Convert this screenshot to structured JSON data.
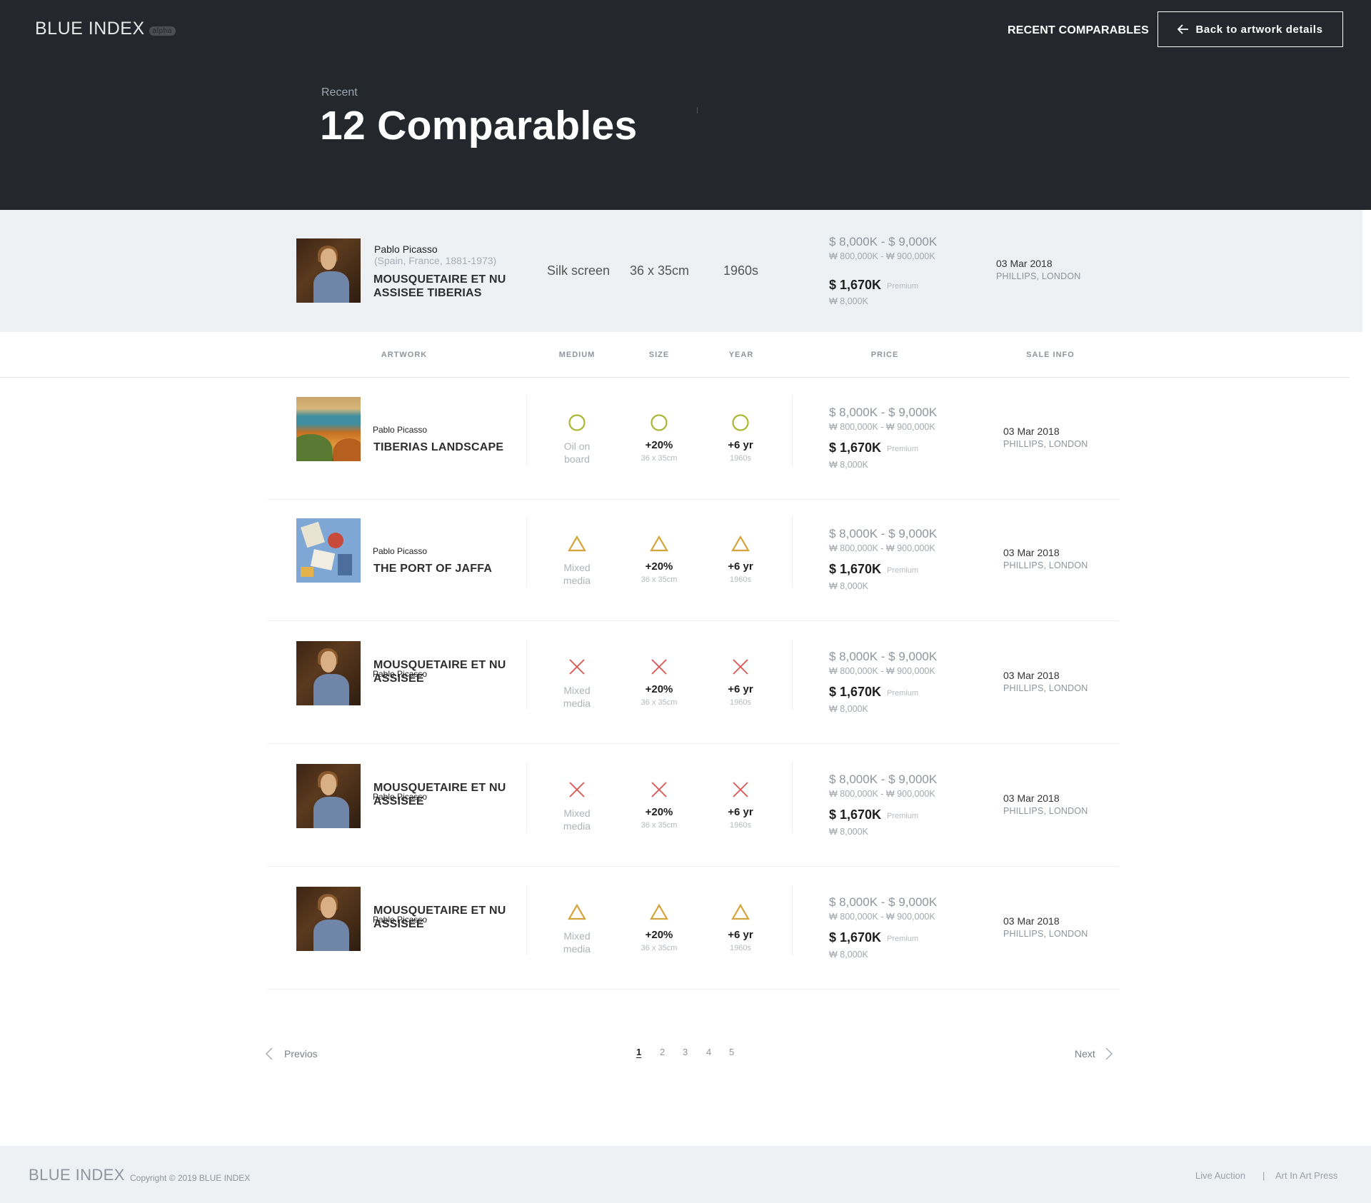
{
  "header": {
    "logo": "BLUE INDEX",
    "logo_badge": "alpha",
    "nav_recent": "RECENT COMPARABLES",
    "back_label": "Back to artwork details",
    "eyebrow": "Recent",
    "title": "12 Comparables"
  },
  "reference": {
    "artist": "Pablo Picasso",
    "artist_info": "(Spain, France, 1881-1973)",
    "title": "MOUSQUETAIRE ET NU ASSISEE TIBERIAS",
    "medium": "Silk screen",
    "size": "36 x 35cm",
    "year": "1960s",
    "estimate_usd": "$ 8,000K - $ 9,000K",
    "estimate_krw": "₩ 800,000K - ₩ 900,000K",
    "price_usd": "$ 1,670K",
    "premium_label": "Premium",
    "price_krw": "₩ 8,000K",
    "sale_date": "03 Mar 2018",
    "sale_house": "PHILLIPS, LONDON"
  },
  "columns": {
    "artwork": "ARTWORK",
    "medium": "MEDIUM",
    "size": "SIZE",
    "year": "YEAR",
    "price": "PRICE",
    "sale_info": "SALE INFO"
  },
  "rows": [
    {
      "artist": "Pablo Picasso",
      "title": "TIBERIAS LANDSCAPE",
      "match": "circle",
      "medium_line1": "Oil on",
      "medium_line2": "board",
      "size_diff": "+20%",
      "size_value": "36 x 35cm",
      "year_diff": "+6 yr",
      "year_value": "1960s",
      "estimate_usd": "$ 8,000K - $ 9,000K",
      "estimate_krw": "₩ 800,000K - ₩ 900,000K",
      "price_usd": "$ 1,670K",
      "premium_label": "Premium",
      "price_krw": "₩ 8,000K",
      "sale_date": "03 Mar 2018",
      "sale_house": "PHILLIPS, LONDON"
    },
    {
      "artist": "Pablo Picasso",
      "title": "THE PORT OF JAFFA",
      "match": "triangle",
      "medium_line1": "Mixed",
      "medium_line2": "media",
      "size_diff": "+20%",
      "size_value": "36 x 35cm",
      "year_diff": "+6 yr",
      "year_value": "1960s",
      "estimate_usd": "$ 8,000K - $ 9,000K",
      "estimate_krw": "₩ 800,000K - ₩ 900,000K",
      "price_usd": "$ 1,670K",
      "premium_label": "Premium",
      "price_krw": "₩ 8,000K",
      "sale_date": "03 Mar 2018",
      "sale_house": "PHILLIPS, LONDON"
    },
    {
      "artist": "Pablo Picasso",
      "title": "MOUSQUETAIRE ET NU ASSISEE",
      "match": "cross",
      "medium_line1": "Mixed",
      "medium_line2": "media",
      "size_diff": "+20%",
      "size_value": "36 x 35cm",
      "year_diff": "+6 yr",
      "year_value": "1960s",
      "estimate_usd": "$ 8,000K - $ 9,000K",
      "estimate_krw": "₩ 800,000K - ₩ 900,000K",
      "price_usd": "$ 1,670K",
      "premium_label": "Premium",
      "price_krw": "₩ 8,000K",
      "sale_date": "03 Mar 2018",
      "sale_house": "PHILLIPS, LONDON"
    },
    {
      "artist": "Pablo Picasso",
      "title": "MOUSQUETAIRE ET NU ASSISEE",
      "match": "cross",
      "medium_line1": "Mixed",
      "medium_line2": "media",
      "size_diff": "+20%",
      "size_value": "36 x 35cm",
      "year_diff": "+6 yr",
      "year_value": "1960s",
      "estimate_usd": "$ 8,000K - $ 9,000K",
      "estimate_krw": "₩ 800,000K - ₩ 900,000K",
      "price_usd": "$ 1,670K",
      "premium_label": "Premium",
      "price_krw": "₩ 8,000K",
      "sale_date": "03 Mar 2018",
      "sale_house": "PHILLIPS, LONDON"
    },
    {
      "artist": "Pablo Picasso",
      "title": "MOUSQUETAIRE ET NU ASSISEE",
      "match": "triangle",
      "medium_line1": "Mixed",
      "medium_line2": "media",
      "size_diff": "+20%",
      "size_value": "36 x 35cm",
      "year_diff": "+6 yr",
      "year_value": "1960s",
      "estimate_usd": "$ 8,000K - $ 9,000K",
      "estimate_krw": "₩ 800,000K - ₩ 900,000K",
      "price_usd": "$ 1,670K",
      "premium_label": "Premium",
      "price_krw": "₩ 8,000K",
      "sale_date": "03 Mar 2018",
      "sale_house": "PHILLIPS, LONDON"
    }
  ],
  "pagination": {
    "prev": "Previos",
    "next": "Next",
    "pages": [
      "1",
      "2",
      "3",
      "4",
      "5"
    ],
    "current": "1"
  },
  "footer": {
    "logo": "BLUE INDEX",
    "copyright": "Copyright © 2019 BLUE INDEX",
    "link_live_auction": "Live Auction",
    "separator": "|",
    "link_art_press": "Art In Art Press"
  },
  "colors": {
    "header_bg": "#24272b",
    "band_bg": "#edf1f4",
    "match_circle": "#a9b832",
    "match_triangle": "#d4a43a",
    "match_cross": "#d9534f"
  }
}
